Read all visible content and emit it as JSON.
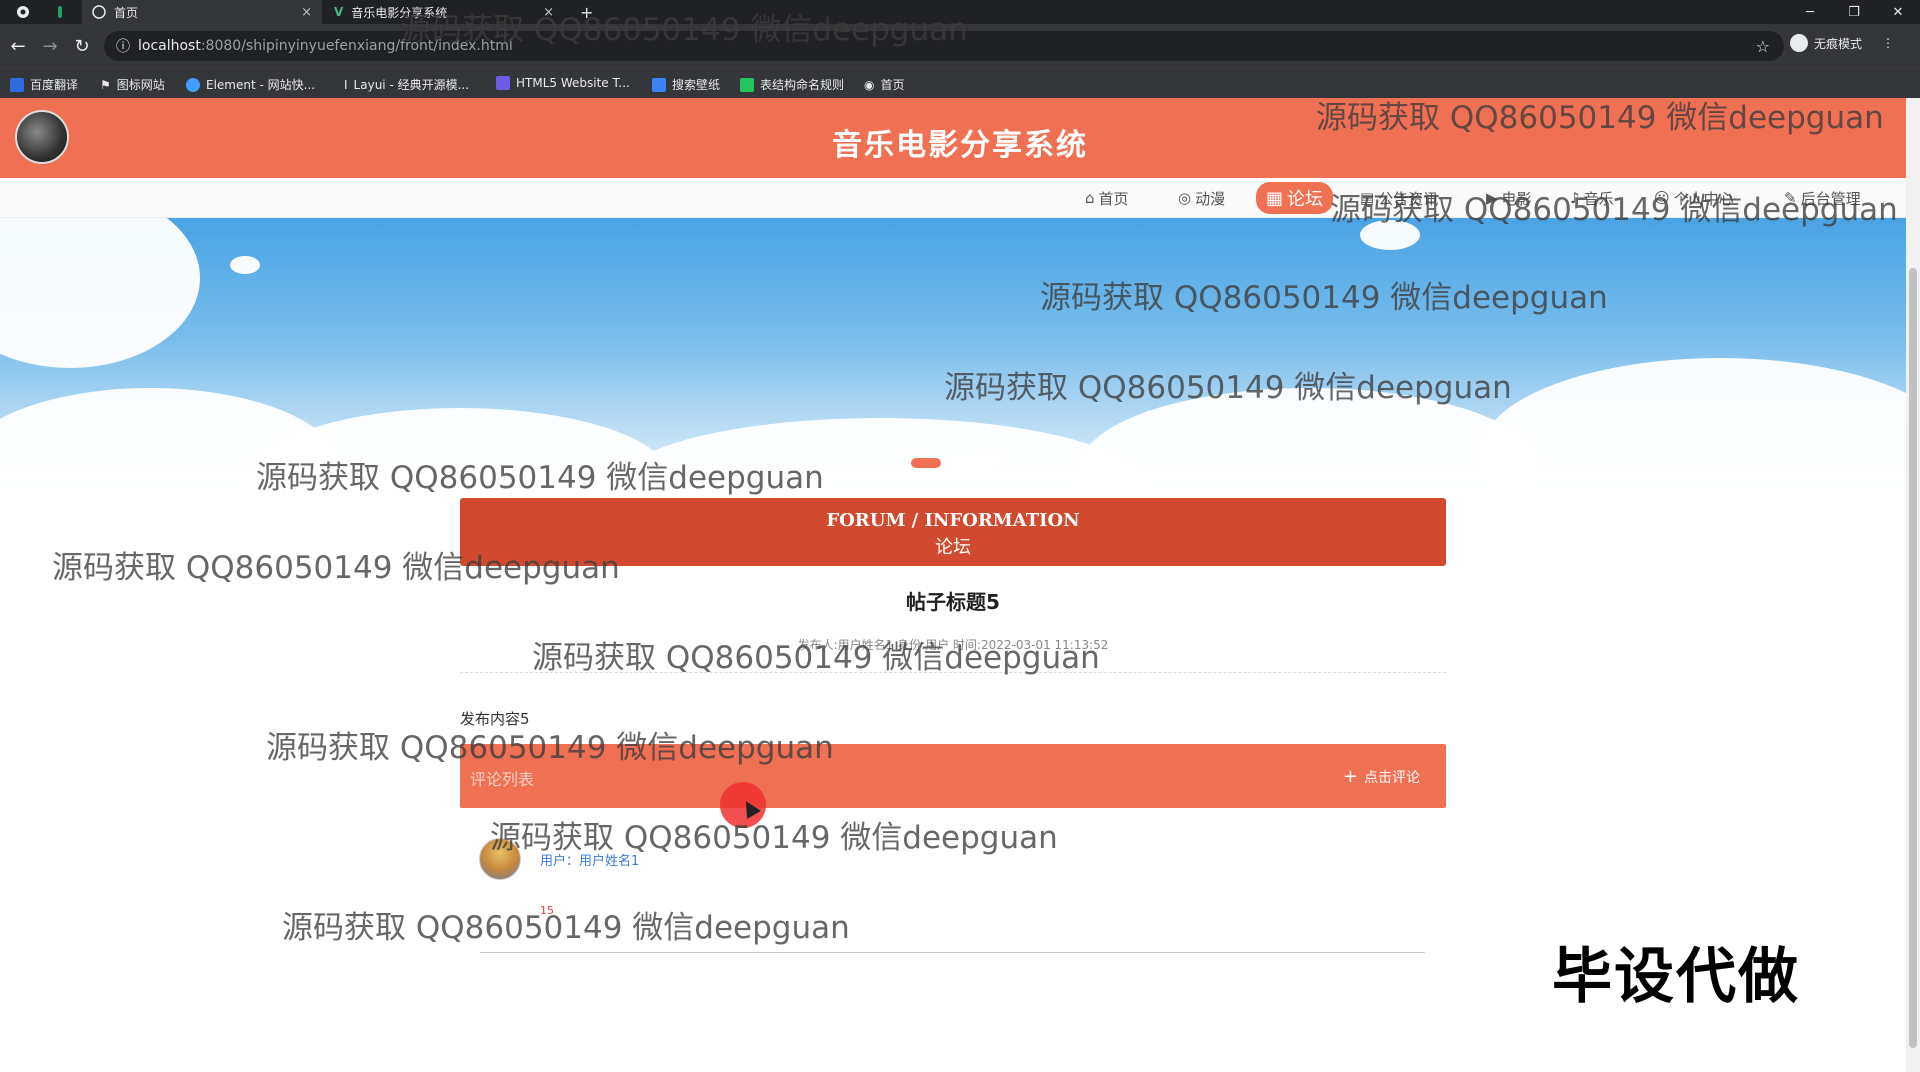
{
  "browser": {
    "tabs": [
      {
        "label": "首页"
      },
      {
        "label": "音乐电影分享系统"
      }
    ],
    "close_glyph": "×",
    "new_tab_glyph": "+",
    "url_host": "localhost",
    "url_path": ":8080/shipinyinyuefenxiang/front/index.html",
    "incognito_label": "无痕模式",
    "bookmarks": [
      {
        "label": "百度翻译",
        "icon": "translate-icon",
        "color": "#2f6bdc"
      },
      {
        "label": "图标网站",
        "icon": "flag-icon",
        "color": "#ffffff"
      },
      {
        "label": "Element - 网站快...",
        "icon": "element-icon",
        "color": "#409eff"
      },
      {
        "label": "Layui - 经典开源模...",
        "icon": "layui-icon",
        "color": "#dddddd"
      },
      {
        "label": "HTML5 Website T...",
        "icon": "html5-icon",
        "color": "#6c5ce7"
      },
      {
        "label": "搜索壁纸",
        "icon": "wallpaper-icon",
        "color": "#3b82f6"
      },
      {
        "label": "表结构命名规则",
        "icon": "table-icon",
        "color": "#22c55e"
      },
      {
        "label": "首页",
        "icon": "home-icon",
        "color": "#ffffff"
      }
    ]
  },
  "site": {
    "title": "音乐电影分享系统",
    "accent": "#f07053",
    "nav": [
      {
        "label": "首页",
        "glyph": "⌂",
        "active": false
      },
      {
        "label": "动漫",
        "glyph": "◎",
        "active": false
      },
      {
        "label": "论坛",
        "glyph": "▦",
        "active": true
      },
      {
        "label": "公告资讯",
        "glyph": "▤",
        "active": false
      },
      {
        "label": "电影",
        "glyph": "▶",
        "active": false
      },
      {
        "label": "音乐",
        "glyph": "♪",
        "active": false
      },
      {
        "label": "个人中心",
        "glyph": "☺",
        "active": false
      },
      {
        "label": "后台管理",
        "glyph": "✎",
        "active": false
      }
    ]
  },
  "forum": {
    "header_en": "FORUM / INFORMATION",
    "header_cn": "论坛",
    "post_title": "帖子标题5",
    "post_meta": "发布人:用户姓名1  身份:用户  时间:2022-03-01 11:13:52",
    "post_content": "发布内容5",
    "comment_list_label": "评论列表",
    "add_comment_label": "点击评论",
    "comments": [
      {
        "user_label": "用户：用户姓名1",
        "mark": "15"
      }
    ]
  },
  "watermark_text": "源码获取 QQ86050149 微信deepguan",
  "corner_mark": "毕设代做"
}
